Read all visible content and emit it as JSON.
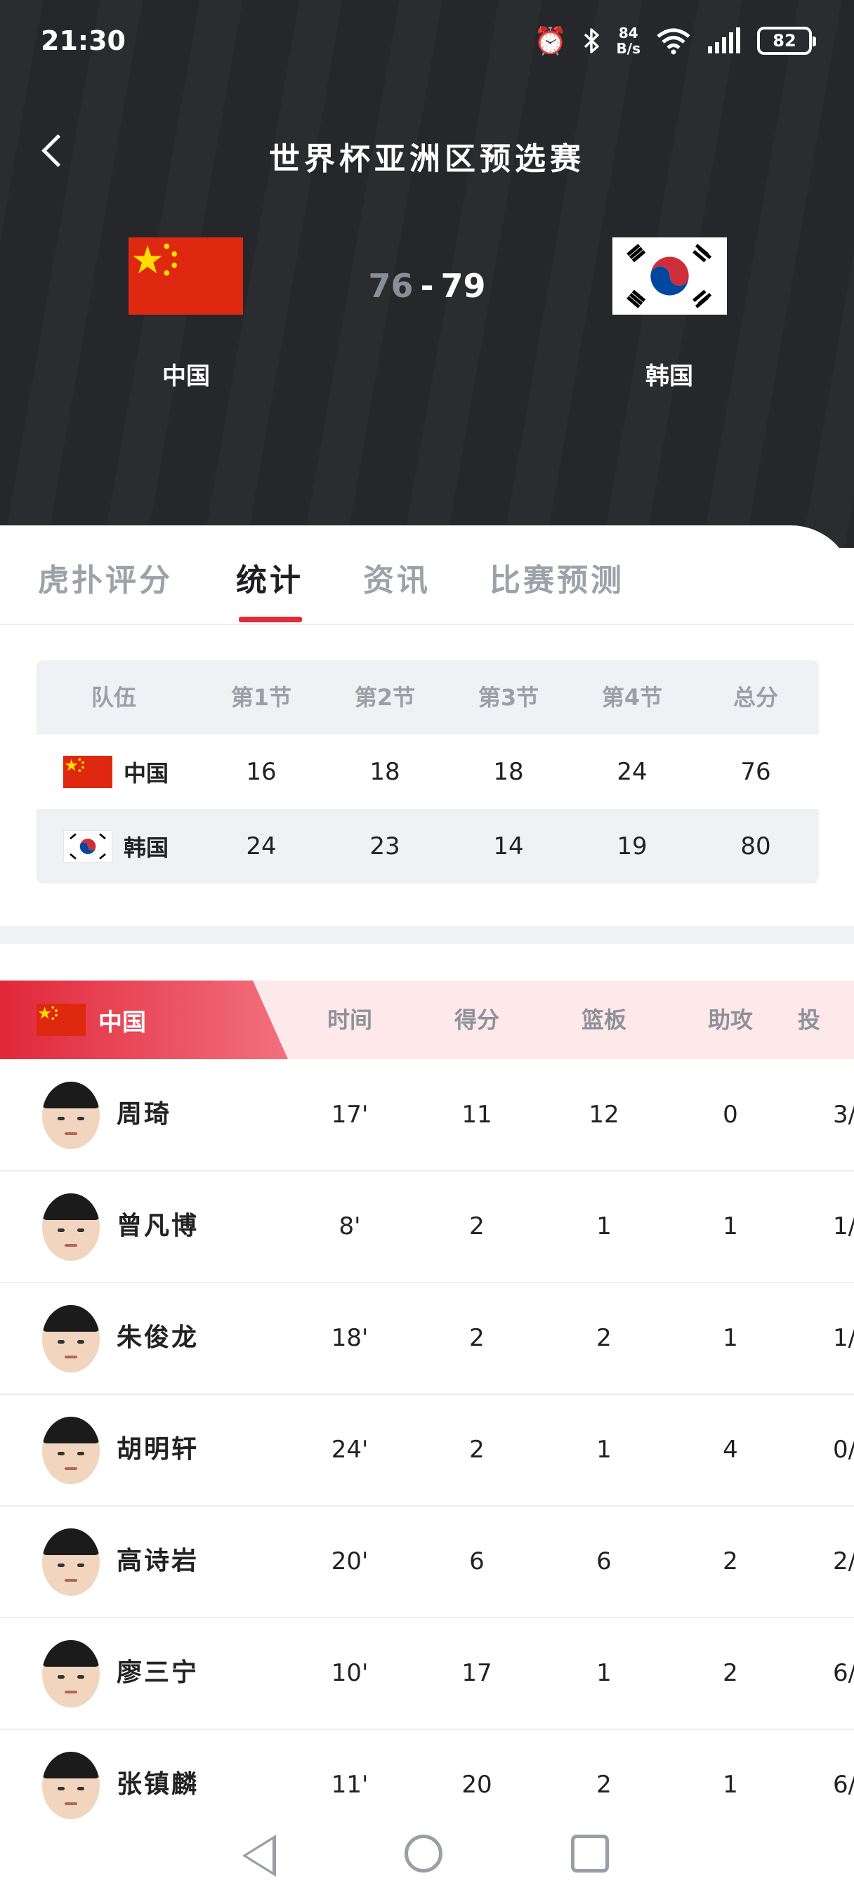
{
  "status_bar": {
    "time": "21:30",
    "net_speed_value": "84",
    "net_speed_unit": "B/s",
    "battery": "82",
    "icons": [
      "alarm-icon",
      "bluetooth-icon",
      "wifi-icon",
      "signal-icon",
      "battery-icon"
    ]
  },
  "header": {
    "title": "世界杯亚洲区预选赛",
    "home_team": "中国",
    "away_team": "韩国",
    "home_score": "76",
    "separator": "-",
    "away_score": "79"
  },
  "tabs": [
    {
      "label": "虎扑评分",
      "active": false
    },
    {
      "label": "统计",
      "active": true
    },
    {
      "label": "资讯",
      "active": false
    },
    {
      "label": "比赛预测",
      "active": false
    }
  ],
  "quarter_table": {
    "headers": [
      "队伍",
      "第1节",
      "第2节",
      "第3节",
      "第4节",
      "总分"
    ],
    "rows": [
      {
        "team": "中国",
        "scores": [
          "16",
          "18",
          "18",
          "24",
          "76"
        ]
      },
      {
        "team": "韩国",
        "scores": [
          "24",
          "23",
          "14",
          "19",
          "80"
        ]
      }
    ]
  },
  "player_table": {
    "team": "中国",
    "headers": [
      "时间",
      "得分",
      "篮板",
      "助攻",
      "投"
    ],
    "players": [
      {
        "name": "周琦",
        "stats": [
          "17'",
          "11",
          "12",
          "0",
          "3/"
        ]
      },
      {
        "name": "曾凡博",
        "stats": [
          "8'",
          "2",
          "1",
          "1",
          "1/"
        ]
      },
      {
        "name": "朱俊龙",
        "stats": [
          "18'",
          "2",
          "2",
          "1",
          "1/"
        ]
      },
      {
        "name": "胡明轩",
        "stats": [
          "24'",
          "2",
          "1",
          "4",
          "0/"
        ]
      },
      {
        "name": "高诗岩",
        "stats": [
          "20'",
          "6",
          "6",
          "2",
          "2/"
        ]
      },
      {
        "name": "廖三宁",
        "stats": [
          "10'",
          "17",
          "1",
          "2",
          "6/"
        ]
      },
      {
        "name": "张镇麟",
        "stats": [
          "11'",
          "20",
          "2",
          "1",
          "6/"
        ]
      }
    ]
  },
  "colors": {
    "header_bg": "#26272b",
    "accent_red": "#e32a38",
    "china_red": "#de2910",
    "table_bg": "#f0f1f4"
  }
}
